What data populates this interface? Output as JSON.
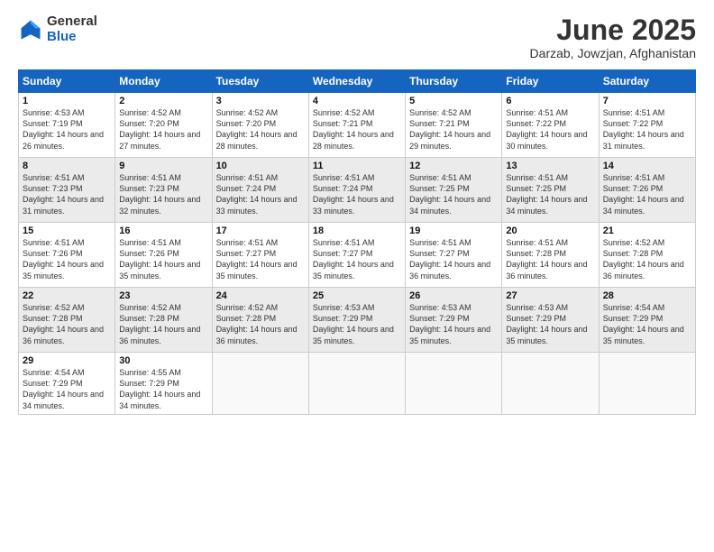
{
  "logo": {
    "general": "General",
    "blue": "Blue"
  },
  "title": "June 2025",
  "subtitle": "Darzab, Jowzjan, Afghanistan",
  "days_header": [
    "Sunday",
    "Monday",
    "Tuesday",
    "Wednesday",
    "Thursday",
    "Friday",
    "Saturday"
  ],
  "weeks": [
    [
      {
        "day": "1",
        "sunrise": "4:53 AM",
        "sunset": "7:19 PM",
        "daylight": "14 hours and 26 minutes."
      },
      {
        "day": "2",
        "sunrise": "4:52 AM",
        "sunset": "7:20 PM",
        "daylight": "14 hours and 27 minutes."
      },
      {
        "day": "3",
        "sunrise": "4:52 AM",
        "sunset": "7:20 PM",
        "daylight": "14 hours and 28 minutes."
      },
      {
        "day": "4",
        "sunrise": "4:52 AM",
        "sunset": "7:21 PM",
        "daylight": "14 hours and 28 minutes."
      },
      {
        "day": "5",
        "sunrise": "4:52 AM",
        "sunset": "7:21 PM",
        "daylight": "14 hours and 29 minutes."
      },
      {
        "day": "6",
        "sunrise": "4:51 AM",
        "sunset": "7:22 PM",
        "daylight": "14 hours and 30 minutes."
      },
      {
        "day": "7",
        "sunrise": "4:51 AM",
        "sunset": "7:22 PM",
        "daylight": "14 hours and 31 minutes."
      }
    ],
    [
      {
        "day": "8",
        "sunrise": "4:51 AM",
        "sunset": "7:23 PM",
        "daylight": "14 hours and 31 minutes."
      },
      {
        "day": "9",
        "sunrise": "4:51 AM",
        "sunset": "7:23 PM",
        "daylight": "14 hours and 32 minutes."
      },
      {
        "day": "10",
        "sunrise": "4:51 AM",
        "sunset": "7:24 PM",
        "daylight": "14 hours and 33 minutes."
      },
      {
        "day": "11",
        "sunrise": "4:51 AM",
        "sunset": "7:24 PM",
        "daylight": "14 hours and 33 minutes."
      },
      {
        "day": "12",
        "sunrise": "4:51 AM",
        "sunset": "7:25 PM",
        "daylight": "14 hours and 34 minutes."
      },
      {
        "day": "13",
        "sunrise": "4:51 AM",
        "sunset": "7:25 PM",
        "daylight": "14 hours and 34 minutes."
      },
      {
        "day": "14",
        "sunrise": "4:51 AM",
        "sunset": "7:26 PM",
        "daylight": "14 hours and 34 minutes."
      }
    ],
    [
      {
        "day": "15",
        "sunrise": "4:51 AM",
        "sunset": "7:26 PM",
        "daylight": "14 hours and 35 minutes."
      },
      {
        "day": "16",
        "sunrise": "4:51 AM",
        "sunset": "7:26 PM",
        "daylight": "14 hours and 35 minutes."
      },
      {
        "day": "17",
        "sunrise": "4:51 AM",
        "sunset": "7:27 PM",
        "daylight": "14 hours and 35 minutes."
      },
      {
        "day": "18",
        "sunrise": "4:51 AM",
        "sunset": "7:27 PM",
        "daylight": "14 hours and 35 minutes."
      },
      {
        "day": "19",
        "sunrise": "4:51 AM",
        "sunset": "7:27 PM",
        "daylight": "14 hours and 36 minutes."
      },
      {
        "day": "20",
        "sunrise": "4:51 AM",
        "sunset": "7:28 PM",
        "daylight": "14 hours and 36 minutes."
      },
      {
        "day": "21",
        "sunrise": "4:52 AM",
        "sunset": "7:28 PM",
        "daylight": "14 hours and 36 minutes."
      }
    ],
    [
      {
        "day": "22",
        "sunrise": "4:52 AM",
        "sunset": "7:28 PM",
        "daylight": "14 hours and 36 minutes."
      },
      {
        "day": "23",
        "sunrise": "4:52 AM",
        "sunset": "7:28 PM",
        "daylight": "14 hours and 36 minutes."
      },
      {
        "day": "24",
        "sunrise": "4:52 AM",
        "sunset": "7:28 PM",
        "daylight": "14 hours and 36 minutes."
      },
      {
        "day": "25",
        "sunrise": "4:53 AM",
        "sunset": "7:29 PM",
        "daylight": "14 hours and 35 minutes."
      },
      {
        "day": "26",
        "sunrise": "4:53 AM",
        "sunset": "7:29 PM",
        "daylight": "14 hours and 35 minutes."
      },
      {
        "day": "27",
        "sunrise": "4:53 AM",
        "sunset": "7:29 PM",
        "daylight": "14 hours and 35 minutes."
      },
      {
        "day": "28",
        "sunrise": "4:54 AM",
        "sunset": "7:29 PM",
        "daylight": "14 hours and 35 minutes."
      }
    ],
    [
      {
        "day": "29",
        "sunrise": "4:54 AM",
        "sunset": "7:29 PM",
        "daylight": "14 hours and 34 minutes."
      },
      {
        "day": "30",
        "sunrise": "4:55 AM",
        "sunset": "7:29 PM",
        "daylight": "14 hours and 34 minutes."
      },
      null,
      null,
      null,
      null,
      null
    ]
  ]
}
